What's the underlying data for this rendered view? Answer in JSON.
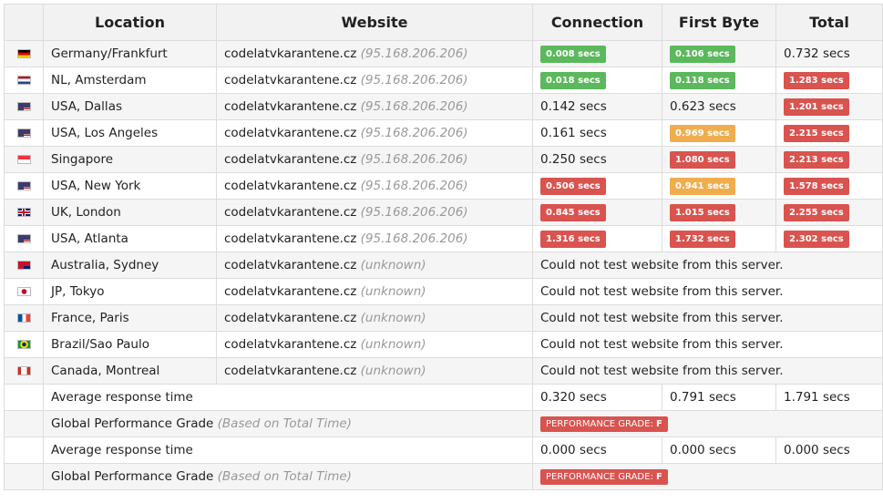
{
  "headers": {
    "flag": "",
    "location": "Location",
    "website": "Website",
    "connection": "Connection",
    "first_byte": "First Byte",
    "total": "Total"
  },
  "rows": [
    {
      "location": "Germany/Frankfurt",
      "site": "codelatvkarantene.cz",
      "ip": "(95.168.206.206)",
      "flag": "de",
      "connection": {
        "text": "0.008 secs",
        "color": "green"
      },
      "first_byte": {
        "text": "0.106 secs",
        "color": "green"
      },
      "total": {
        "text": "0.732 secs",
        "color": "none"
      }
    },
    {
      "location": "NL, Amsterdam",
      "site": "codelatvkarantene.cz",
      "ip": "(95.168.206.206)",
      "flag": "nl",
      "connection": {
        "text": "0.018 secs",
        "color": "green"
      },
      "first_byte": {
        "text": "0.118 secs",
        "color": "green"
      },
      "total": {
        "text": "1.283 secs",
        "color": "red"
      }
    },
    {
      "location": "USA, Dallas",
      "site": "codelatvkarantene.cz",
      "ip": "(95.168.206.206)",
      "flag": "us",
      "connection": {
        "text": "0.142 secs",
        "color": "none"
      },
      "first_byte": {
        "text": "0.623 secs",
        "color": "none"
      },
      "total": {
        "text": "1.201 secs",
        "color": "red"
      }
    },
    {
      "location": "USA, Los Angeles",
      "site": "codelatvkarantene.cz",
      "ip": "(95.168.206.206)",
      "flag": "us",
      "connection": {
        "text": "0.161 secs",
        "color": "none"
      },
      "first_byte": {
        "text": "0.969 secs",
        "color": "orange"
      },
      "total": {
        "text": "2.215 secs",
        "color": "red"
      }
    },
    {
      "location": "Singapore",
      "site": "codelatvkarantene.cz",
      "ip": "(95.168.206.206)",
      "flag": "sg",
      "connection": {
        "text": "0.250 secs",
        "color": "none"
      },
      "first_byte": {
        "text": "1.080 secs",
        "color": "red"
      },
      "total": {
        "text": "2.213 secs",
        "color": "red"
      }
    },
    {
      "location": "USA, New York",
      "site": "codelatvkarantene.cz",
      "ip": "(95.168.206.206)",
      "flag": "us",
      "connection": {
        "text": "0.506 secs",
        "color": "red"
      },
      "first_byte": {
        "text": "0.941 secs",
        "color": "orange"
      },
      "total": {
        "text": "1.578 secs",
        "color": "red"
      }
    },
    {
      "location": "UK, London",
      "site": "codelatvkarantene.cz",
      "ip": "(95.168.206.206)",
      "flag": "uk",
      "connection": {
        "text": "0.845 secs",
        "color": "red"
      },
      "first_byte": {
        "text": "1.015 secs",
        "color": "red"
      },
      "total": {
        "text": "2.255 secs",
        "color": "red"
      }
    },
    {
      "location": "USA, Atlanta",
      "site": "codelatvkarantene.cz",
      "ip": "(95.168.206.206)",
      "flag": "us",
      "connection": {
        "text": "1.316 secs",
        "color": "red"
      },
      "first_byte": {
        "text": "1.732 secs",
        "color": "red"
      },
      "total": {
        "text": "2.302 secs",
        "color": "red"
      }
    },
    {
      "location": "Australia, Sydney",
      "site": "codelatvkarantene.cz",
      "ip": "(unknown)",
      "flag": "au",
      "error": "Could not test website from this server."
    },
    {
      "location": "JP, Tokyo",
      "site": "codelatvkarantene.cz",
      "ip": "(unknown)",
      "flag": "jp",
      "error": "Could not test website from this server."
    },
    {
      "location": "France, Paris",
      "site": "codelatvkarantene.cz",
      "ip": "(unknown)",
      "flag": "fr",
      "error": "Could not test website from this server."
    },
    {
      "location": "Brazil/Sao Paulo",
      "site": "codelatvkarantene.cz",
      "ip": "(unknown)",
      "flag": "br",
      "error": "Could not test website from this server."
    },
    {
      "location": "Canada, Montreal",
      "site": "codelatvkarantene.cz",
      "ip": "(unknown)",
      "flag": "ca",
      "error": "Could not test website from this server."
    }
  ],
  "summary": [
    {
      "type": "avg",
      "label": "Average response time",
      "connection": "0.320 secs",
      "first_byte": "0.791 secs",
      "total": "1.791 secs"
    },
    {
      "type": "grade",
      "label": "Global Performance Grade",
      "note": "(Based on Total Time)",
      "grade_label": "PERFORMANCE GRADE:",
      "grade": "F"
    },
    {
      "type": "avg",
      "label": "Average response time",
      "connection": "0.000 secs",
      "first_byte": "0.000 secs",
      "total": "0.000 secs"
    },
    {
      "type": "grade",
      "label": "Global Performance Grade",
      "note": "(Based on Total Time)",
      "grade_label": "PERFORMANCE GRADE:",
      "grade": "F"
    }
  ],
  "colors": {
    "green": "#5cb85c",
    "orange": "#f0ad4e",
    "red": "#d9534f"
  }
}
